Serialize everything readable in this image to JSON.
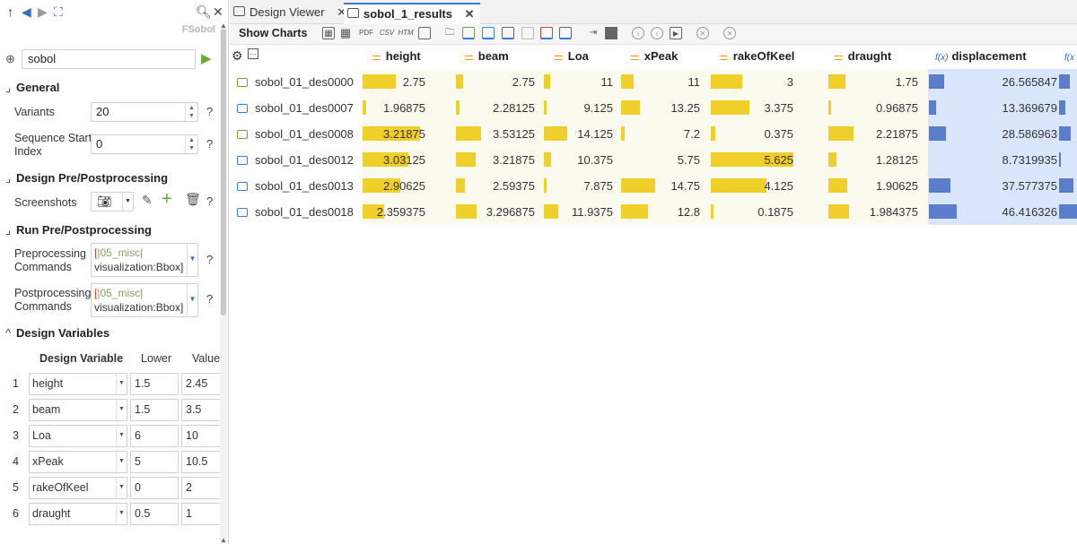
{
  "left": {
    "title": "FSobol",
    "name": "sobol",
    "general": {
      "title": "General",
      "variants_label": "Variants",
      "variants_value": "20",
      "seq_label_1": "Sequence Start",
      "seq_label_2": "Index",
      "seq_value": "0"
    },
    "design_pp": {
      "title": "Design Pre/Postprocessing",
      "screenshots_label": "Screenshots"
    },
    "run_pp": {
      "title": "Run Pre/Postprocessing",
      "pre_label_1": "Preprocessing",
      "pre_label_2": "Commands",
      "pre_bracket": "[",
      "pre_line1": "|05_misc|",
      "pre_line2": "visualization:Bbox]",
      "post_label_1": "Postprocessing",
      "post_label_2": "Commands",
      "post_bracket": "[",
      "post_line1": "|05_misc|",
      "post_line2": "visualization:Bbox]"
    },
    "design_vars": {
      "title": "Design Variables",
      "col_var": "Design Variable",
      "col_lower": "Lower",
      "col_value": "Value",
      "rows": [
        {
          "idx": "1",
          "name": "height",
          "lower": "1.5",
          "value": "2.45"
        },
        {
          "idx": "2",
          "name": "beam",
          "lower": "1.5",
          "value": "3.5"
        },
        {
          "idx": "3",
          "name": "Loa",
          "lower": "6",
          "value": "10"
        },
        {
          "idx": "4",
          "name": "xPeak",
          "lower": "5",
          "value": "10.5"
        },
        {
          "idx": "5",
          "name": "rakeOfKeel",
          "lower": "0",
          "value": "2"
        },
        {
          "idx": "6",
          "name": "draught",
          "lower": "0.5",
          "value": "1"
        }
      ]
    }
  },
  "tabs": [
    {
      "label": "Design Viewer",
      "active": false
    },
    {
      "label": "sobol_1_results",
      "active": true
    }
  ],
  "toolbar": {
    "show_charts": "Show Charts",
    "pdf": "PDF",
    "csv": "CSV",
    "htm": "HTM"
  },
  "columns": [
    "height",
    "beam",
    "Loa",
    "xPeak",
    "rakeOfKeel",
    "draught",
    "displacement"
  ],
  "rows": [
    {
      "name": "sobol_01_des0000",
      "icon": "green",
      "height": "2.75",
      "beam": "2.75",
      "Loa": "11",
      "xPeak": "11",
      "rakeOfKeel": "3",
      "draught": "1.75",
      "displacement": "26.565847",
      "bars": {
        "height": 0.55,
        "beam": 0.25,
        "Loa": 0.25,
        "xPeak": 0.38,
        "rakeOfKeel": 0.38,
        "draught": 0.5,
        "displacement": 0.55
      }
    },
    {
      "name": "sobol_01_des0007",
      "icon": "blue",
      "height": "1.96875",
      "beam": "2.28125",
      "Loa": "9.125",
      "xPeak": "13.25",
      "rakeOfKeel": "3.375",
      "draught": "0.96875",
      "displacement": "13.369679",
      "bars": {
        "height": 0.06,
        "beam": 0.12,
        "Loa": 0.06,
        "xPeak": 0.56,
        "rakeOfKeel": 0.47,
        "draught": 0.06,
        "displacement": 0.27
      }
    },
    {
      "name": "sobol_01_des0008",
      "icon": "green",
      "height": "3.21875",
      "beam": "3.53125",
      "Loa": "14.125",
      "xPeak": "7.2",
      "rakeOfKeel": "0.375",
      "draught": "2.21875",
      "displacement": "28.586963",
      "bars": {
        "height": 0.94,
        "beam": 0.88,
        "Loa": 1.0,
        "xPeak": 0.1,
        "rakeOfKeel": 0.05,
        "draught": 0.76,
        "displacement": 0.6
      }
    },
    {
      "name": "sobol_01_des0012",
      "icon": "blue",
      "height": "3.03125",
      "beam": "3.21875",
      "Loa": "10.375",
      "xPeak": "5.75",
      "rakeOfKeel": "5.625",
      "draught": "1.28125",
      "displacement": "8.7319935",
      "bars": {
        "height": 0.75,
        "beam": 0.69,
        "Loa": 0.31,
        "xPeak": 0.0,
        "rakeOfKeel": 1.0,
        "draught": 0.25,
        "displacement": 0.0
      }
    },
    {
      "name": "sobol_01_des0013",
      "icon": "blue",
      "height": "2.90625",
      "beam": "2.59375",
      "Loa": "7.875",
      "xPeak": "14.75",
      "rakeOfKeel": "4.125",
      "draught": "1.90625",
      "displacement": "37.577375",
      "bars": {
        "height": 0.62,
        "beam": 0.31,
        "Loa": 0.06,
        "xPeak": 1.0,
        "rakeOfKeel": 0.67,
        "draught": 0.58,
        "displacement": 0.77
      }
    },
    {
      "name": "sobol_01_des0018",
      "icon": "blue",
      "height": "2.359375",
      "beam": "3.296875",
      "Loa": "11.9375",
      "xPeak": "12.8",
      "rakeOfKeel": "0.1875",
      "draught": "1.984375",
      "displacement": "46.416326",
      "bars": {
        "height": 0.36,
        "beam": 0.72,
        "Loa": 0.63,
        "xPeak": 0.8,
        "rakeOfKeel": 0.03,
        "draught": 0.62,
        "displacement": 1.0
      }
    }
  ],
  "colors": {
    "bar": "#f0cf2a",
    "disp_bar": "#5a7dcc",
    "accent": "#3a7bd5"
  }
}
